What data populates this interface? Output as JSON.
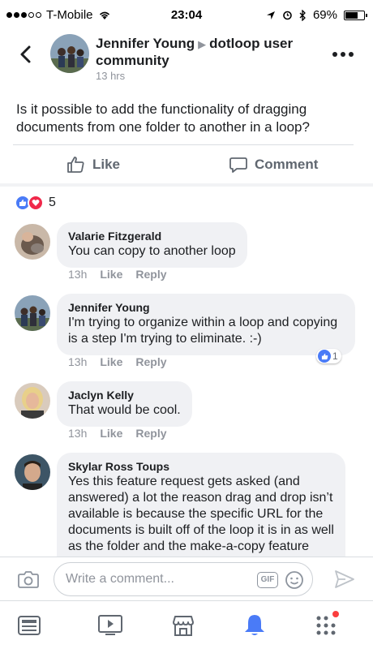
{
  "status_bar": {
    "carrier": "T-Mobile",
    "time": "23:04",
    "battery": "69%",
    "battery_level": 0.69
  },
  "post": {
    "author": "Jennifer Young",
    "group": "dotloop user community",
    "time": "13 hrs",
    "text": "Is it possible to add the functionality of dragging documents from one folder to another in a loop?",
    "like_label": "Like",
    "comment_label": "Comment",
    "reaction_count": "5"
  },
  "comments": [
    {
      "name": "Valarie Fitzgerald",
      "text": "You can copy to another loop",
      "time": "13h",
      "like": "Like",
      "reply": "Reply"
    },
    {
      "name": "Jennifer Young",
      "text": "I'm trying to organize within a loop and copying is a step I'm trying to eliminate. :-)",
      "time": "13h",
      "like": "Like",
      "reply": "Reply",
      "reactions": "1"
    },
    {
      "name": "Jaclyn Kelly",
      "text": "That would be cool.",
      "time": "13h",
      "like": "Like",
      "reply": "Reply"
    },
    {
      "name": "Skylar Ross Toups",
      "text": "Yes this feature request gets asked (and answered) a lot the reason drag and drop isn’t available is because the specific URL for the documents is built off of the loop it is in as well as the folder and the make-a-copy feature rewrites the document URL to"
    }
  ],
  "composer": {
    "placeholder": "Write a comment...",
    "gif_label": "GIF"
  },
  "colors": {
    "accent": "#4a7bf7",
    "heart": "#f0284a",
    "notification": "#fa3e3e"
  }
}
